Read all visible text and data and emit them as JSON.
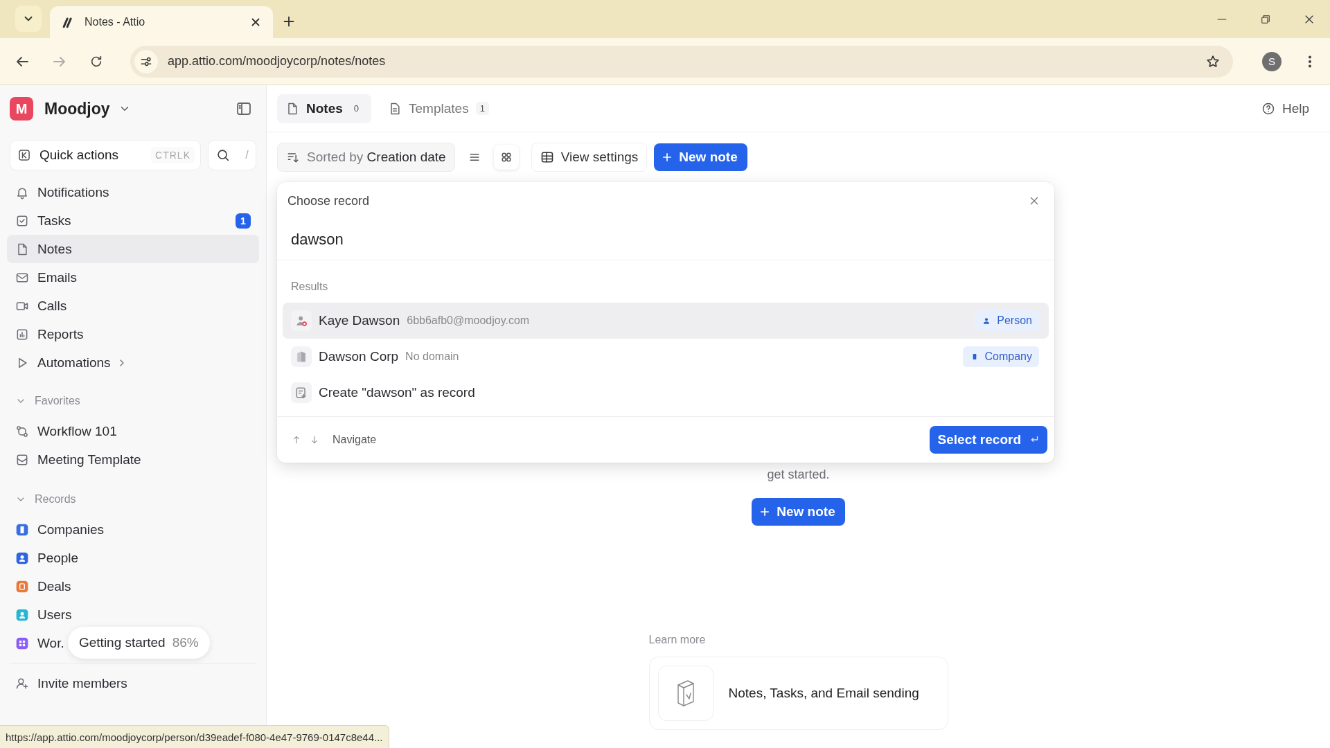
{
  "browser": {
    "tabs": [
      {
        "title": "Notes - Attio",
        "selected": true
      }
    ],
    "url": "app.attio.com/moodjoycorp/notes/notes",
    "profile_initial": "S",
    "status_url": "https://app.attio.com/moodjoycorp/person/d39eadef-f080-4e47-9769-0147c8e44..."
  },
  "sidebar": {
    "workspace": {
      "initial": "M",
      "name": "Moodjoy"
    },
    "quick_actions": {
      "label": "Quick actions",
      "shortcut": "CTRLK",
      "search_shortcut": "/"
    },
    "nav": [
      {
        "label": "Notifications",
        "selected": false,
        "has_submenu": false
      },
      {
        "label": "Tasks",
        "selected": false,
        "has_submenu": false,
        "badge": "1"
      },
      {
        "label": "Notes",
        "selected": true,
        "has_submenu": false
      },
      {
        "label": "Emails",
        "selected": false,
        "has_submenu": false
      },
      {
        "label": "Calls",
        "selected": false,
        "has_submenu": false
      },
      {
        "label": "Reports",
        "selected": false,
        "has_submenu": false
      },
      {
        "label": "Automations",
        "selected": false,
        "has_submenu": true
      }
    ],
    "sections": [
      {
        "title": "Favorites",
        "expanded": true,
        "items": [
          {
            "label": "Workflow 101"
          },
          {
            "label": "Meeting Template"
          }
        ]
      },
      {
        "title": "Records",
        "expanded": true,
        "items": [
          {
            "label": "Companies",
            "color": "#3b6fe0"
          },
          {
            "label": "People",
            "color": "#2f66e0"
          },
          {
            "label": "Deals",
            "color": "#ea7a3c"
          },
          {
            "label": "Users",
            "color": "#25b6d2"
          },
          {
            "label": "Wor.",
            "color": "#8b5cf6"
          }
        ]
      }
    ],
    "getting_started": {
      "label": "Getting started",
      "progress": "86%"
    },
    "invite": "Invite members"
  },
  "main": {
    "tabs": [
      {
        "label": "Notes",
        "count": "0",
        "selected": true
      },
      {
        "label": "Templates",
        "count": "1",
        "selected": false
      }
    ],
    "help": "Help",
    "sort": "Sorted by **Creation date**",
    "view_modes": [
      {
        "selected": false
      },
      {
        "selected": true
      }
    ],
    "view_settings": "View settings",
    "new_note": "New note",
    "empty_state": {
      "message": "get started.",
      "button": "New note"
    },
    "learn_more": {
      "heading": "Learn more",
      "cards": [
        {
          "title": "Notes, Tasks, and Email sending"
        }
      ]
    }
  },
  "dialog": {
    "title": "Choose record",
    "query": "dawson",
    "section": "Results",
    "results": [
      {
        "kind": "person",
        "name": "Kaye Dawson",
        "detail": "6bb6afb0@moodjoy.com",
        "tag": "Person",
        "selected": true
      },
      {
        "kind": "company",
        "name": "Dawson Corp",
        "detail": "No domain",
        "tag": "Company",
        "selected": false
      },
      {
        "kind": "create",
        "name": "Create \"dawson\" as record",
        "selected": false
      }
    ],
    "hint": "Navigate",
    "action": "Select record"
  }
}
